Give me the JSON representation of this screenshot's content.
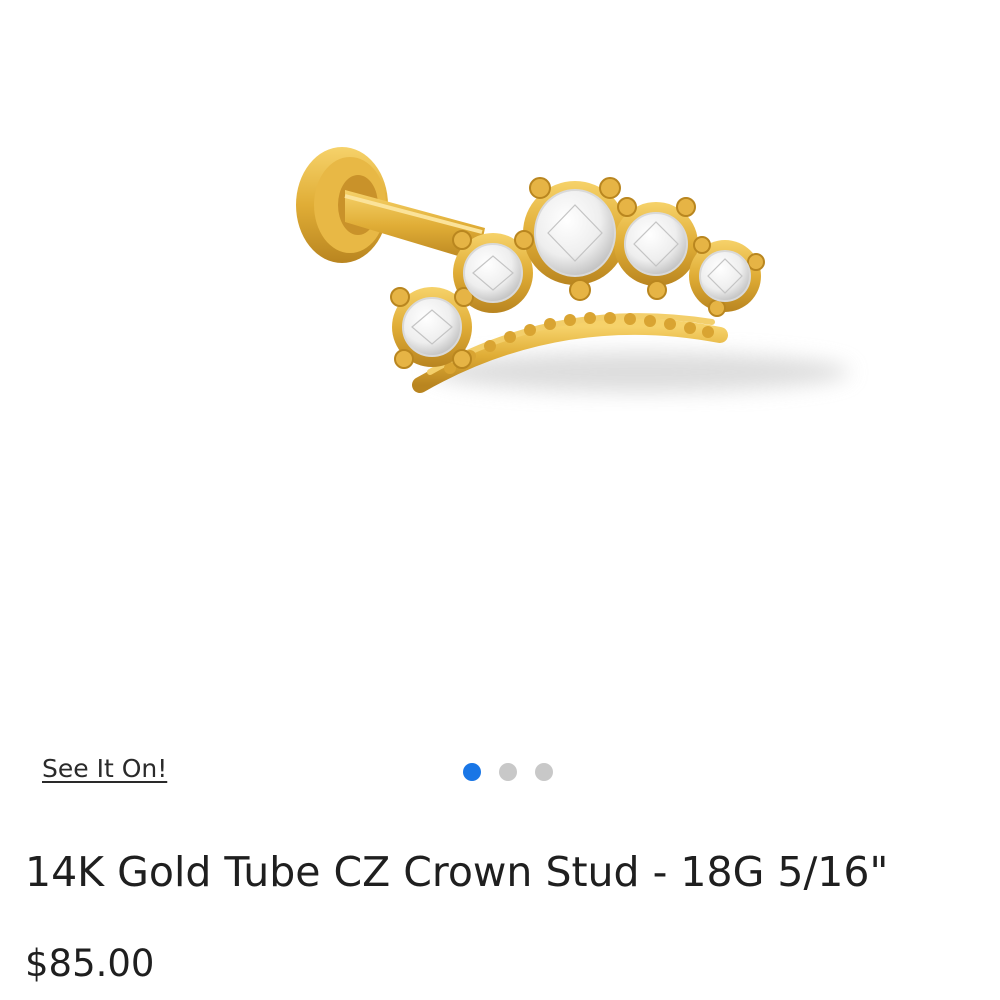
{
  "gallery": {
    "see_it_on_label": "See It On!",
    "dots": [
      {
        "active": true
      },
      {
        "active": false
      },
      {
        "active": false
      }
    ],
    "active_color": "#1976e6",
    "inactive_color": "#c8c8c8"
  },
  "product": {
    "title": "14K Gold Tube CZ Crown Stud - 18G 5/16\"",
    "price": "$85.00",
    "metal_color": "#d9a832"
  }
}
